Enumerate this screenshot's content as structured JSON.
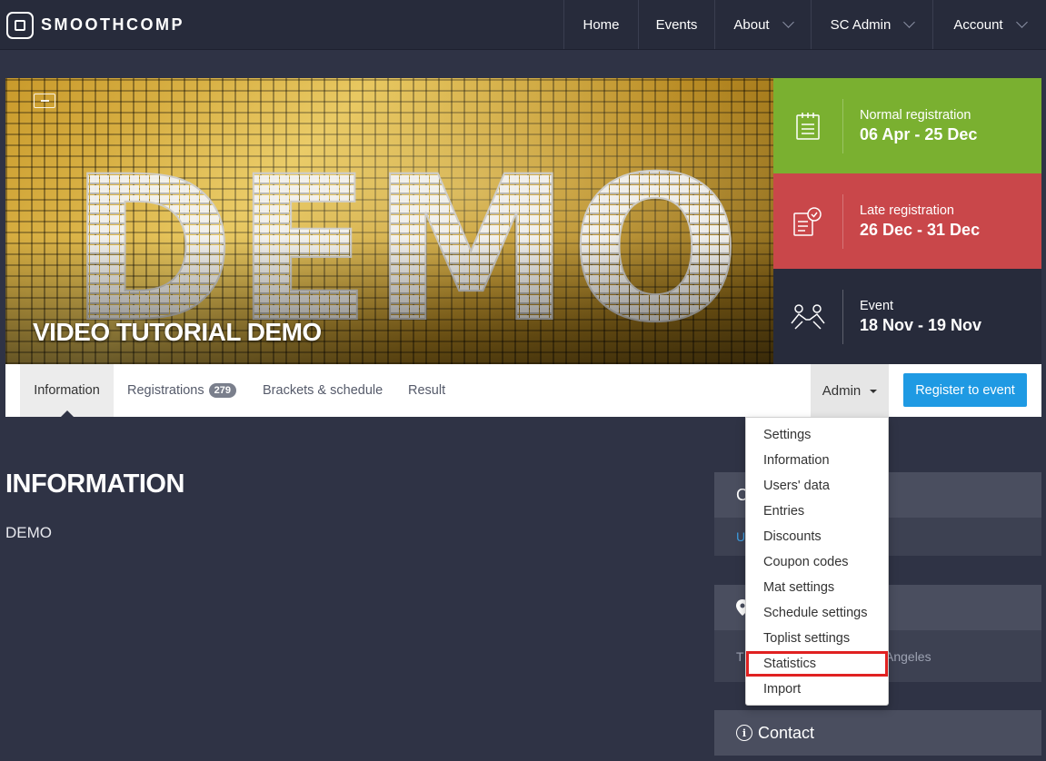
{
  "navbar": {
    "brand": "SMOOTHCOMP",
    "items": [
      {
        "label": "Home",
        "has_dropdown": false
      },
      {
        "label": "Events",
        "has_dropdown": false
      },
      {
        "label": "About",
        "has_dropdown": true
      },
      {
        "label": "SC Admin",
        "has_dropdown": true
      },
      {
        "label": "Account",
        "has_dropdown": true
      }
    ]
  },
  "hero": {
    "image_text": "DEMO",
    "title": "VIDEO TUTORIAL DEMO"
  },
  "info_boxes": [
    {
      "label": "Normal registration",
      "date": "06 Apr - 25 Dec",
      "color": "#7ab030",
      "icon": "clipboard-icon"
    },
    {
      "label": "Late registration",
      "date": "26 Dec - 31 Dec",
      "color": "#c9474a",
      "icon": "clipboard-clock-icon"
    },
    {
      "label": "Event",
      "date": "18 Nov - 19 Nov",
      "color": "#272b3b",
      "icon": "grappling-icon"
    }
  ],
  "tabs": [
    {
      "label": "Information",
      "active": true
    },
    {
      "label": "Registrations",
      "badge": "279"
    },
    {
      "label": "Brackets & schedule"
    },
    {
      "label": "Result"
    }
  ],
  "admin": {
    "label": "Admin",
    "menu": [
      "Settings",
      "Information",
      "Users' data",
      "Entries",
      "Discounts",
      "Coupon codes",
      "Mat settings",
      "Schedule settings",
      "Toplist settings",
      "Statistics",
      "Import"
    ],
    "highlighted": "Statistics"
  },
  "register_button": "Register to event",
  "main": {
    "title": "INFORMATION",
    "body": "DEMO"
  },
  "side": {
    "panel1_head": "C",
    "panel1_row": "U",
    "panel2_row_start": "T",
    "panel2_row_end": "Angeles",
    "contact": "Contact"
  },
  "colors": {
    "accent": "#1f9ae3",
    "green": "#7ab030",
    "red": "#c9474a",
    "highlight": "#e02121"
  }
}
